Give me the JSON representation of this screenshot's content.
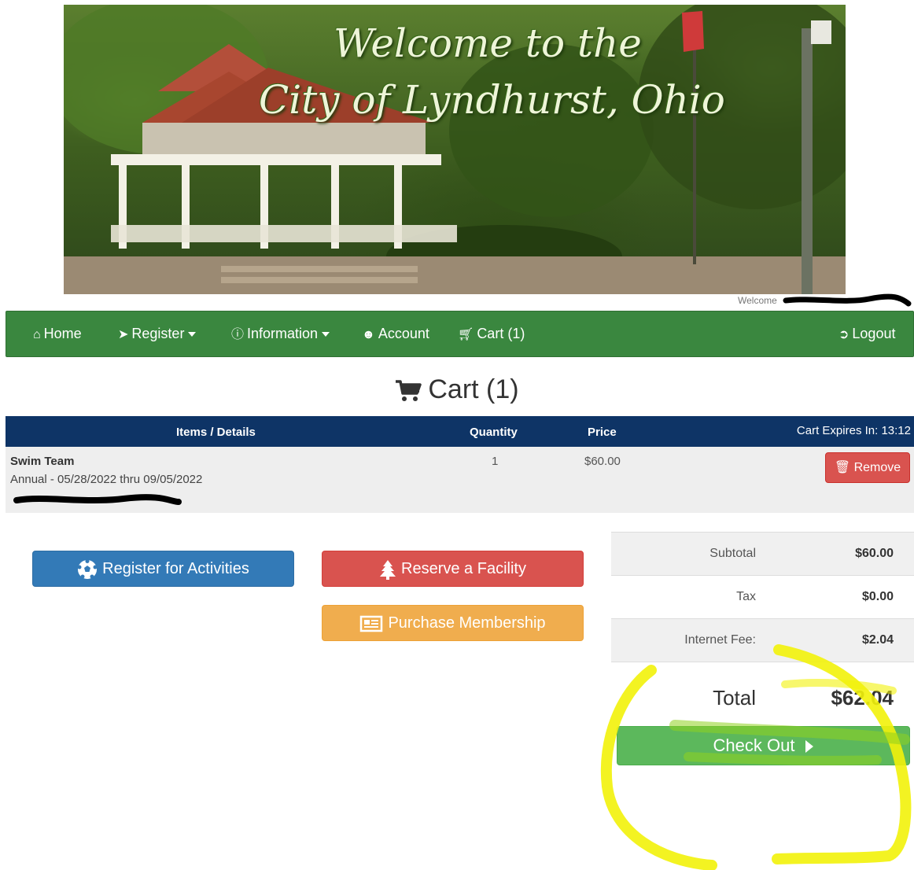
{
  "banner": {
    "title_line1": "Welcome to the",
    "title_line2": "City of Lyndhurst, Ohio"
  },
  "welcome_text": "Welcome",
  "nav": {
    "home": "Home",
    "register": "Register",
    "information": "Information",
    "account": "Account",
    "cart": "Cart (1)",
    "logout": "Logout"
  },
  "page_title": "Cart (1)",
  "table": {
    "headers": {
      "items": "Items / Details",
      "quantity": "Quantity",
      "price": "Price",
      "expires": "Cart Expires In: 13:12"
    },
    "rows": [
      {
        "name": "Swim Team",
        "detail": "Annual - 05/28/2022 thru 09/05/2022",
        "quantity": "1",
        "price": "$60.00",
        "remove_label": "Remove"
      }
    ]
  },
  "actions": {
    "register_activities": "Register for Activities",
    "reserve_facility": "Reserve a Facility",
    "purchase_membership": "Purchase Membership"
  },
  "totals": {
    "subtotal_label": "Subtotal",
    "subtotal_value": "$60.00",
    "tax_label": "Tax",
    "tax_value": "$0.00",
    "fee_label": "Internet Fee:",
    "fee_value": "$2.04",
    "total_label": "Total",
    "total_value": "$62.04",
    "checkout_label": "Check Out"
  },
  "colors": {
    "nav_green": "#3a873f",
    "table_header_navy": "#0e3466",
    "primary_blue": "#337ab7",
    "danger_red": "#d9534f",
    "warning_orange": "#f0ad4e",
    "success_green": "#5cb85c",
    "highlight_yellow": "#f2f20a"
  }
}
